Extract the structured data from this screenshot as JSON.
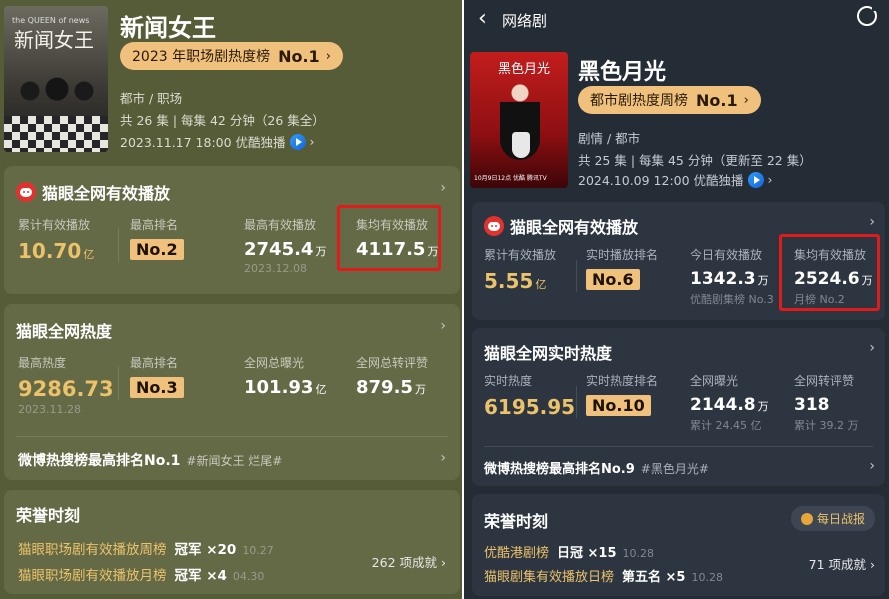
{
  "left": {
    "show": {
      "title": "新闻女王",
      "poster_caption": "the QUEEN of news",
      "poster_title": "新闻女王",
      "rank_label": "2023 年职场剧热度榜",
      "rank_value": "No.1",
      "genres": "都市 / 职场",
      "episodes": "共 26 集 | 每集 42 分钟（26 集全）",
      "release": "2023.11.17 18:00 优酷独播"
    },
    "playback": {
      "title": "猫眼全网有效播放",
      "stats": [
        {
          "label": "累计有效播放",
          "value": "10.70",
          "unit": "亿"
        },
        {
          "label": "最高排名",
          "badge": "No.2"
        },
        {
          "label": "最高有效播放",
          "value": "2745.4",
          "unit": "万",
          "sub": "2023.12.08"
        },
        {
          "label": "集均有效播放",
          "value": "4117.5",
          "unit": "万"
        }
      ]
    },
    "heat": {
      "title": "猫眼全网热度",
      "stats": [
        {
          "label": "最高热度",
          "value": "9286.73",
          "sub": "2023.11.28"
        },
        {
          "label": "最高排名",
          "badge": "No.3"
        },
        {
          "label": "全网总曝光",
          "value": "101.93",
          "unit": "亿"
        },
        {
          "label": "全网总转评赞",
          "value": "879.5",
          "unit": "万"
        }
      ],
      "weibo_main": "微博热搜榜最高排名No.1",
      "weibo_tag": "#新闻女王 烂尾#"
    },
    "honors": {
      "title": "荣誉时刻",
      "items": [
        {
          "name": "猫眼职场剧有效播放周榜",
          "rank": "冠军 ×20",
          "date": "10.27"
        },
        {
          "name": "猫眼职场剧有效播放月榜",
          "rank": "冠军 ×4",
          "date": "04.30"
        }
      ],
      "count": "262 项成就"
    }
  },
  "right": {
    "nav_title": "网络剧",
    "show": {
      "title": "黑色月光",
      "poster_title": "黑色月光",
      "poster_caption": "10月9日12点 优酷 腾讯TV",
      "rank_label": "都市剧热度周榜",
      "rank_value": "No.1",
      "genres": "剧情 / 都市",
      "episodes": "共 25 集 | 每集 45 分钟（更新至 22 集）",
      "release": "2024.10.09 12:00 优酷独播"
    },
    "playback": {
      "title": "猫眼全网有效播放",
      "stats": [
        {
          "label": "累计有效播放",
          "value": "5.55",
          "unit": "亿"
        },
        {
          "label": "实时播放排名",
          "badge": "No.6"
        },
        {
          "label": "今日有效播放",
          "value": "1342.3",
          "unit": "万",
          "sub": "优酷剧集榜 No.3"
        },
        {
          "label": "集均有效播放",
          "value": "2524.6",
          "unit": "万",
          "sub": "月榜 No.2"
        }
      ]
    },
    "heat": {
      "title": "猫眼全网实时热度",
      "stats": [
        {
          "label": "实时热度",
          "value": "6195.95"
        },
        {
          "label": "实时热度排名",
          "badge": "No.10"
        },
        {
          "label": "全网曝光",
          "value": "2144.8",
          "unit": "万",
          "sub": "累计 24.45 亿"
        },
        {
          "label": "全网转评赞",
          "value": "318",
          "sub": "累计 39.2 万"
        }
      ],
      "weibo_main": "微博热搜榜最高排名No.9",
      "weibo_tag": "#黑色月光#"
    },
    "honors": {
      "title": "荣誉时刻",
      "report_btn": "每日战报",
      "items": [
        {
          "name": "优酷港剧榜",
          "rank": "日冠 ×15",
          "date": "10.28"
        },
        {
          "name": "猫眼剧集有效播放日榜",
          "rank": "第五名 ×5",
          "date": "10.28"
        }
      ],
      "count": "71 项成就"
    }
  },
  "colors": {
    "left_bg": "#565c37",
    "right_bg": "#242c36",
    "gold": "#ecc26a",
    "badge": "#f0c17c",
    "highlight_red": "#e01b1b"
  }
}
